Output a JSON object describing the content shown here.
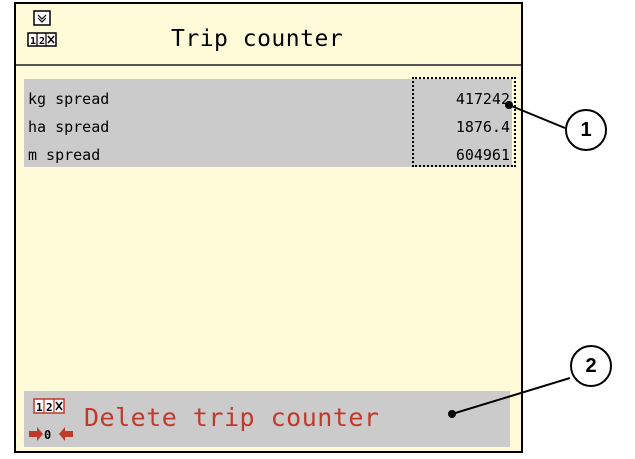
{
  "header": {
    "title": "Trip counter",
    "icon": "trip-counter-icon"
  },
  "counters": [
    {
      "label": "kg spread",
      "value": "417242"
    },
    {
      "label": "ha spread",
      "value": "1876.4"
    },
    {
      "label": "m spread",
      "value": "604961"
    }
  ],
  "footer": {
    "delete_label": "Delete trip counter",
    "icon": "reset-counter-icon"
  },
  "callouts": [
    "1",
    "2"
  ],
  "colors": {
    "screen_background": "#fffbd8",
    "row_background": "#cbcbcb",
    "delete_text": "#c0392b"
  }
}
